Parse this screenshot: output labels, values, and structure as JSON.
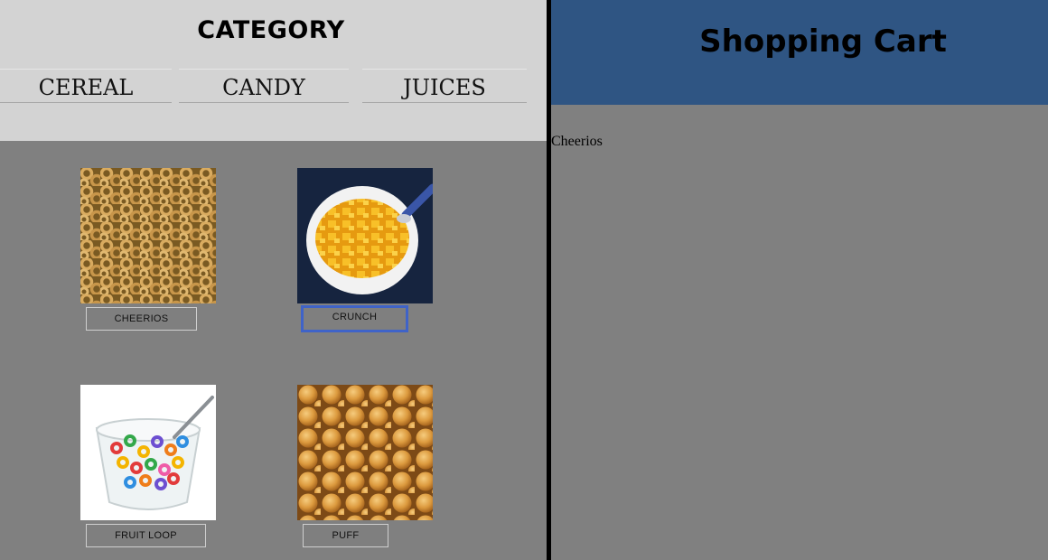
{
  "category": {
    "title": "CATEGORY",
    "tabs": [
      {
        "label": "CEREAL"
      },
      {
        "label": "CANDY"
      },
      {
        "label": "JUICES"
      }
    ]
  },
  "products": [
    {
      "label": "CHEERIOS",
      "image": "cheerios-cereal-image"
    },
    {
      "label": "CRUNCH",
      "image": "crunch-cereal-bowl-image",
      "focused": true
    },
    {
      "label": "FRUIT LOOP",
      "image": "fruit-loop-bowl-image"
    },
    {
      "label": "PUFF",
      "image": "puff-cereal-image"
    }
  ],
  "cart": {
    "title": "Shopping Cart",
    "items": [
      "Cheerios"
    ]
  },
  "colors": {
    "category_header_bg": "#d3d3d3",
    "page_bg": "#808080",
    "cart_header_bg": "#2f5583",
    "focus_ring": "#3f63c8"
  }
}
